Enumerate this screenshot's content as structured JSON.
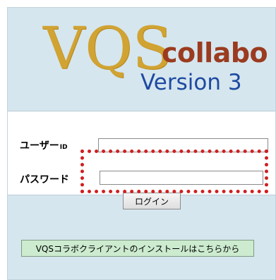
{
  "logo": {
    "brand": "VQS",
    "product": "collabo",
    "version": "Version 3"
  },
  "login_form": {
    "user_label": "ユーザー",
    "user_suffix": "ID",
    "user_value": "",
    "password_label": "パスワード",
    "password_value": "",
    "login_button": "ログイン"
  },
  "install": {
    "button_label": "VQSコラボクライアントのインストールはこちらから"
  },
  "colors": {
    "background": "#d5e6ee",
    "brand_gold": "#d1a332",
    "collabo_red": "#9b3b1f",
    "version_blue": "#1f4aa1",
    "highlight_red": "#cf2020",
    "install_button_green": "#ccebcf"
  }
}
